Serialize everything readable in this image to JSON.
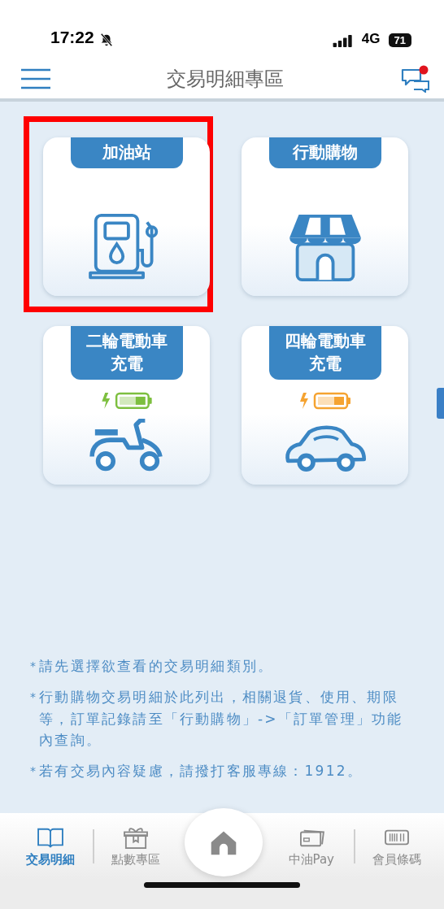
{
  "status_bar": {
    "time": "17:22",
    "network": "4G",
    "battery": "71"
  },
  "header": {
    "title": "交易明細專區",
    "has_unread": true
  },
  "tiles": [
    {
      "label": "加油站",
      "kind": "fuel",
      "highlighted": true
    },
    {
      "label": "行動購物",
      "kind": "shop",
      "highlighted": false
    },
    {
      "label": "二輪電動車充電",
      "kind": "scooter",
      "highlighted": false,
      "color": "#7dbf3f"
    },
    {
      "label": "四輪電動車充電",
      "kind": "car",
      "highlighted": false,
      "color": "#f5a331"
    }
  ],
  "notes": [
    "請先選擇欲查看的交易明細類別。",
    "行動購物交易明細於此列出，相關退貨、使用、期限等，訂單記錄請至「行動購物」->「訂單管理」功能內查詢。",
    "若有交易內容疑慮，請撥打客服專線：1912。"
  ],
  "note_marker": "*",
  "nav": [
    {
      "label": "交易明細",
      "kind": "book",
      "selected": true
    },
    {
      "label": "點數專區",
      "kind": "gift",
      "selected": false
    },
    {
      "kind": "home"
    },
    {
      "label": "中油Pay",
      "kind": "card",
      "selected": false
    },
    {
      "label": "會員條碼",
      "kind": "barcode",
      "selected": false
    }
  ]
}
